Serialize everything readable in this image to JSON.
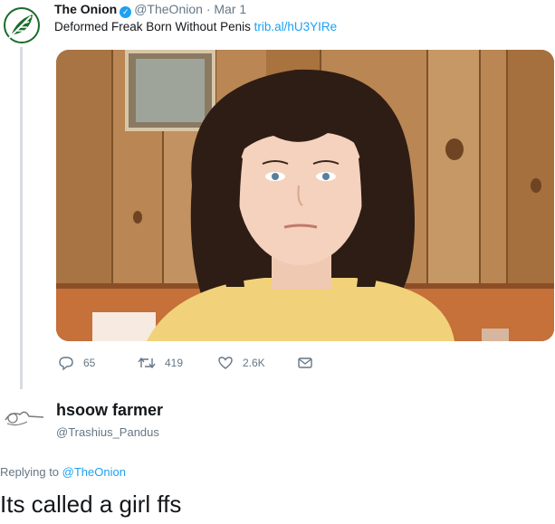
{
  "tweet": {
    "author_name": "The Onion",
    "handle": "@TheOnion",
    "separator": "·",
    "date": "Mar 1",
    "text": "Deformed Freak Born Without Penis",
    "link": "trib.al/hU3YIRe",
    "verified_icon": "verified-check-icon",
    "avatar_icon": "onion-logo-icon"
  },
  "actions": {
    "replies": "65",
    "retweets": "419",
    "likes": "2.6K"
  },
  "reply": {
    "author_name": "hsoow farmer",
    "handle": "@Trashius_Pandus",
    "replying_prefix": "Replying to",
    "replying_to": "@TheOnion",
    "text": "Its called a girl ffs"
  },
  "colors": {
    "link_blue": "#1da1f2",
    "muted_gray": "#657786",
    "onion_green": "#1a6b2a"
  }
}
